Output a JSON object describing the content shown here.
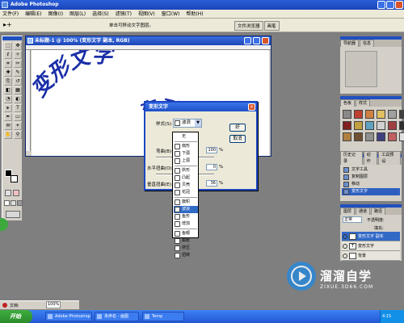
{
  "window": {
    "title": "Adobe Photoshop"
  },
  "menubar": {
    "items": [
      "文件(F)",
      "编辑(E)",
      "图像(I)",
      "图层(L)",
      "选择(S)",
      "滤镜(T)",
      "视图(V)",
      "窗口(W)",
      "帮助(H)"
    ]
  },
  "options_bar": {
    "hint": "单击可移动文字图层。"
  },
  "dock": {
    "tabs": [
      "文件浏览器",
      "画笔"
    ]
  },
  "document": {
    "title": "未标题-1 @ 100% (变形文字 副本, RGB)",
    "arc_text": "变形文字",
    "wave_text": "变形文字",
    "text_color": "#1a2ea8"
  },
  "dialog": {
    "title": "变形文字",
    "style_label": "样式(S):",
    "style_value": "波浪",
    "ok": "好",
    "cancel": "取消",
    "bend_label": "弯曲(B):",
    "bend_value": "100",
    "hdistort_label": "水平扭曲(O):",
    "hdistort_value": "0",
    "vdistort_label": "垂直扭曲(E):",
    "vdistort_value": "36",
    "percent": "%"
  },
  "style_dropdown": {
    "items": [
      {
        "label": "无",
        "selected": false
      },
      {
        "label": "扇形",
        "selected": false
      },
      {
        "label": "下弧",
        "selected": false
      },
      {
        "label": "上弧",
        "selected": false
      },
      {
        "label": "拱形",
        "selected": false
      },
      {
        "label": "凸起",
        "selected": false
      },
      {
        "label": "贝壳",
        "selected": false
      },
      {
        "label": "花冠",
        "selected": false
      },
      {
        "label": "旗帜",
        "selected": false
      },
      {
        "label": "波浪",
        "selected": true
      },
      {
        "label": "鱼形",
        "selected": false
      },
      {
        "label": "增加",
        "selected": false
      },
      {
        "label": "鱼眼",
        "selected": false
      },
      {
        "label": "膨胀",
        "selected": false
      },
      {
        "label": "挤压",
        "selected": false
      },
      {
        "label": "扭转",
        "selected": false
      }
    ]
  },
  "panels": {
    "navigator_tabs": [
      "导航器",
      "信息"
    ],
    "swatches_tabs": [
      "色板",
      "样式"
    ],
    "history_tabs": [
      "历史记录",
      "动作",
      "工具预设"
    ],
    "history_items": [
      {
        "label": "文字工具",
        "selected": false
      },
      {
        "label": "复制图层",
        "selected": false
      },
      {
        "label": "移动",
        "selected": false
      },
      {
        "label": "变形文字",
        "selected": true
      }
    ],
    "layers_tabs": [
      "图层",
      "通道",
      "路径"
    ],
    "layers_mode": "正常",
    "layers_opacity_label": "不透明度:",
    "layers_fill_label": "填充:",
    "layers": [
      {
        "name": "变形文字 副本",
        "thumb": "T",
        "selected": true
      },
      {
        "name": "变形文字",
        "thumb": "T",
        "selected": false
      },
      {
        "name": "背景",
        "thumb": "",
        "selected": false
      }
    ]
  },
  "status": {
    "zoom": "100%",
    "info": "文档:"
  },
  "taskbar": {
    "start": "开始",
    "tasks": [
      "Adobe Photoshop",
      "未命名 - 画图",
      "Temp"
    ],
    "clock": "4:15"
  },
  "watermark": {
    "title": "溜溜自学",
    "subtitle": "ZIXUE.3D66.COM"
  }
}
